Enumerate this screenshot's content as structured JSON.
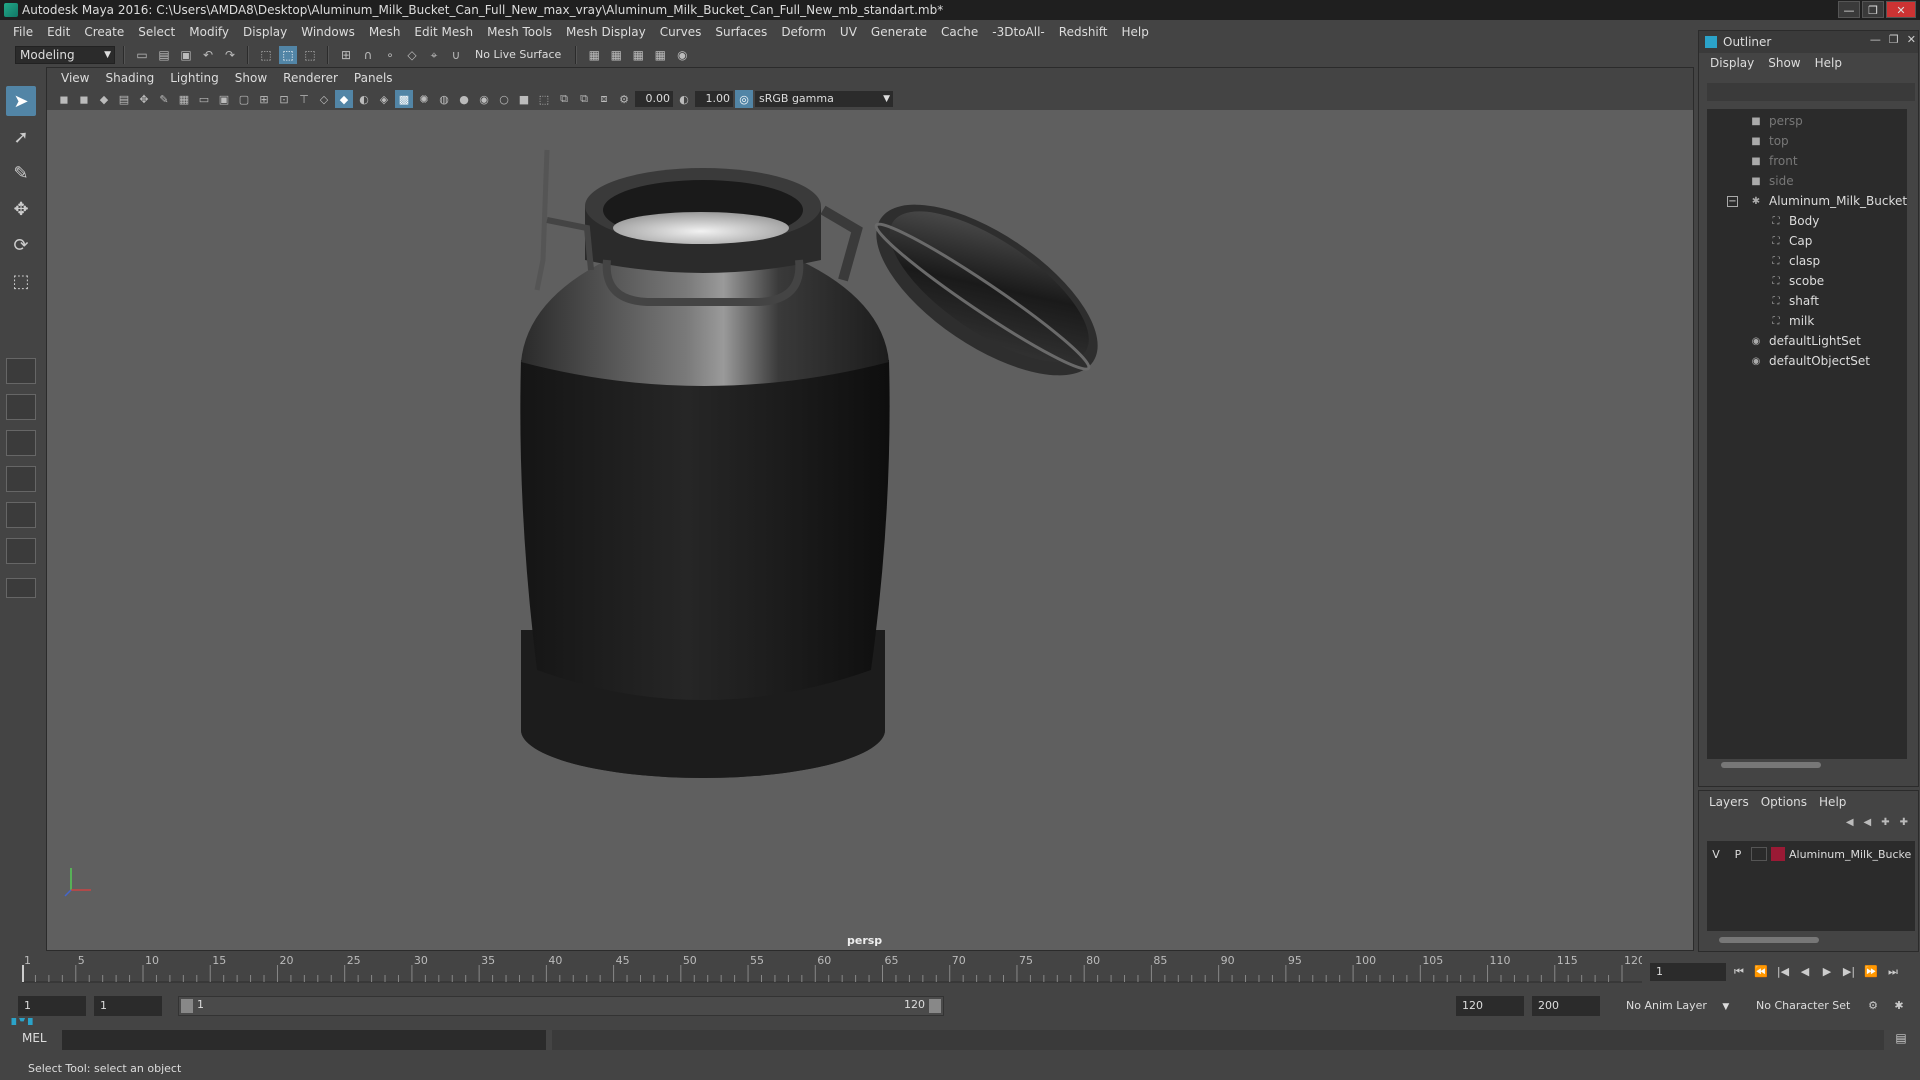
{
  "window": {
    "title": "Autodesk Maya 2016: C:\\Users\\AMDA8\\Desktop\\Aluminum_Milk_Bucket_Can_Full_New_max_vray\\Aluminum_Milk_Bucket_Can_Full_New_mb_standart.mb*",
    "minimize": "—",
    "maximize": "❐",
    "close": "✕"
  },
  "menubar": [
    "File",
    "Edit",
    "Create",
    "Select",
    "Modify",
    "Display",
    "Windows",
    "Mesh",
    "Edit Mesh",
    "Mesh Tools",
    "Mesh Display",
    "Curves",
    "Surfaces",
    "Deform",
    "UV",
    "Generate",
    "Cache",
    "-3DtoAll-",
    "Redshift",
    "Help"
  ],
  "shelf": {
    "mode": "Modeling",
    "live_surface": "No Live Surface"
  },
  "viewport": {
    "menu": [
      "View",
      "Shading",
      "Lighting",
      "Show",
      "Renderer",
      "Panels"
    ],
    "exposure": "0.00",
    "gamma": "1.00",
    "color_space": "sRGB gamma",
    "camera_label": "persp"
  },
  "timeline": {
    "ticks": [
      "1",
      "5",
      "10",
      "15",
      "20",
      "25",
      "30",
      "35",
      "40",
      "45",
      "50",
      "55",
      "60",
      "65",
      "70",
      "75",
      "80",
      "85",
      "90",
      "95",
      "100",
      "105",
      "110",
      "115",
      "120"
    ],
    "current_frame": "1"
  },
  "range": {
    "start": "1",
    "playback_start": "1",
    "slider_start": "1",
    "slider_end": "120",
    "playback_end": "120",
    "end": "200",
    "anim_layer": "No Anim Layer",
    "character_set": "No Character Set"
  },
  "command": {
    "language": "MEL"
  },
  "help_line": "Select Tool: select an object",
  "outliner": {
    "title": "Outliner",
    "menu": [
      "Display",
      "Show",
      "Help"
    ],
    "items": [
      {
        "label": "persp",
        "dim": true
      },
      {
        "label": "top",
        "dim": true
      },
      {
        "label": "front",
        "dim": true
      },
      {
        "label": "side",
        "dim": true
      },
      {
        "label": "Aluminum_Milk_Bucket_C"
      },
      {
        "label": "Body"
      },
      {
        "label": "Cap"
      },
      {
        "label": "clasp"
      },
      {
        "label": "scobe"
      },
      {
        "label": "shaft"
      },
      {
        "label": "milk"
      },
      {
        "label": "defaultLightSet"
      },
      {
        "label": "defaultObjectSet"
      }
    ]
  },
  "layers": {
    "menu": [
      "Layers",
      "Options",
      "Help"
    ],
    "row": {
      "visible": "V",
      "playback": "P",
      "name": "Aluminum_Milk_Bucke",
      "color": "#9a1a35"
    }
  },
  "colors": {
    "accent": "#5285a6",
    "maya_logo": "#2ba3c9",
    "viewport_bg": "#5f5f5f"
  }
}
